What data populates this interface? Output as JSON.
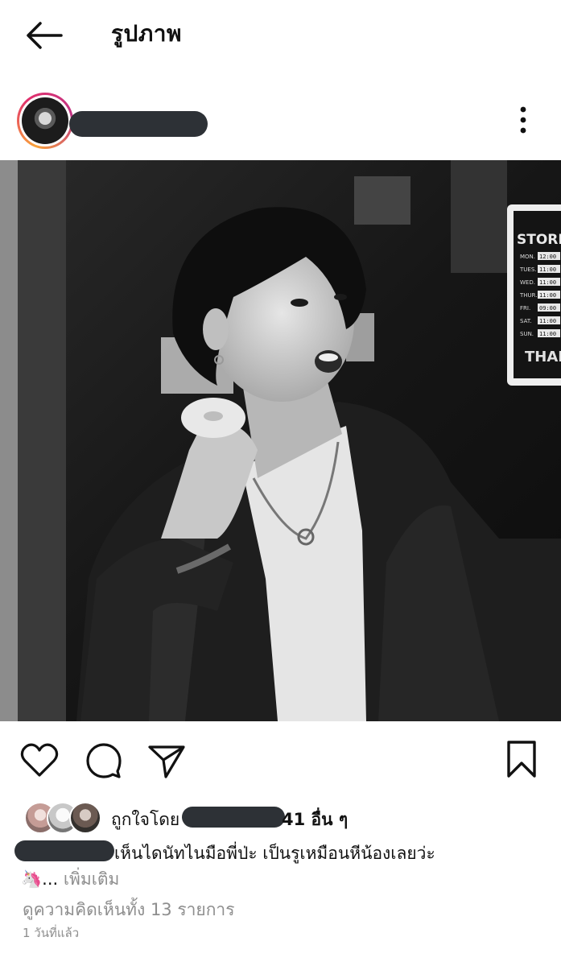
{
  "header": {
    "title": "รูปภาพ"
  },
  "post": {
    "caption": {
      "text": "เห็นไดนัทไนมือพี่ป่ะ เป็นรูเหมือนหีน้องเลยว่ะ",
      "line2_prefix": "🦄...",
      "more": " เพิ่มเติม"
    }
  },
  "photo": {
    "sign": {
      "title": "STORE H",
      "days": [
        "MON.",
        "TUES.",
        "WED.",
        "THUR.",
        "FRI.",
        "SAT.",
        "SUN."
      ],
      "times": [
        "12:00",
        "11:00",
        "11:00",
        "11:00",
        "09:00",
        "11:00",
        "11:00"
      ],
      "footer": "THAN"
    }
  },
  "likes": {
    "prefix": "ถูกใจโดย",
    "others": "41 อื่น ๆ"
  },
  "comments_link": "ดูความคิดเห็นทั้ง 13 รายการ",
  "time_ago": "1 วันที่แล้ว",
  "icons": {
    "back": "arrow-left-icon",
    "more": "more-vertical-icon",
    "like": "heart-icon",
    "comment": "comment-icon",
    "share": "send-icon",
    "save": "bookmark-icon"
  }
}
